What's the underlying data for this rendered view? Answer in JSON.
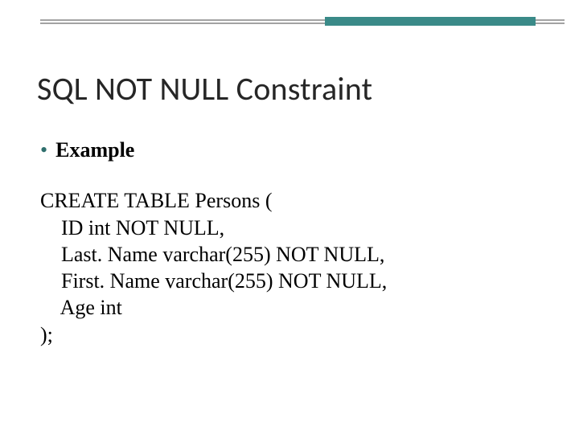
{
  "title": "SQL NOT NULL Constraint",
  "bullet": "Example",
  "code": {
    "l1": "CREATE TABLE Persons (",
    "l2": "    ID int NOT NULL,",
    "l3": "    Last. Name varchar(255) NOT NULL,",
    "l4": "    First. Name varchar(255) NOT NULL,",
    "l5": "    Age int",
    "l6": ");"
  }
}
